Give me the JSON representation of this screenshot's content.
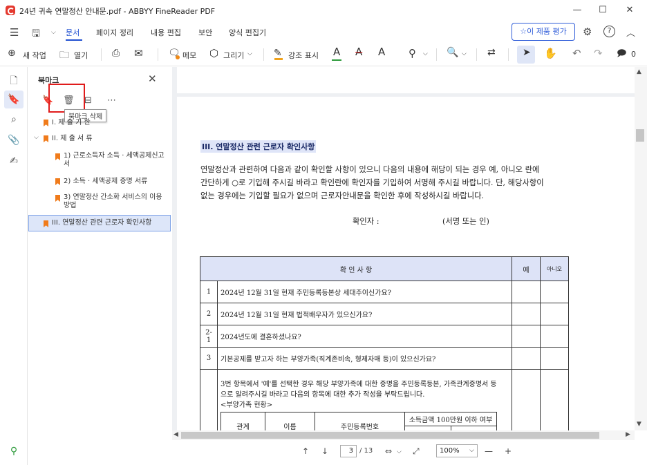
{
  "window": {
    "title": "24년 귀속 연말정산 안내문.pdf - ABBYY FineReader PDF",
    "minimize": "—",
    "maximize": "☐",
    "close": "✕"
  },
  "menu": {
    "items": [
      "문서",
      "페이지 정리",
      "내용 편집",
      "보안",
      "양식 편집기"
    ],
    "rate_label": "이 제품 평가"
  },
  "toolbar": {
    "new_task": "새 작업",
    "open": "열기",
    "memo": "메모",
    "draw": "그리기",
    "highlight": "강조 표시",
    "comment_count": "0"
  },
  "panel": {
    "title": "북마크",
    "tooltip": "북마크 삭제",
    "bookmarks": [
      {
        "label": "I. 제 출 기 한"
      },
      {
        "label": "II. 제 출 서 류"
      },
      {
        "label": "1) 근로소득자 소득 · 세액공제신고서"
      },
      {
        "label": "2) 소득 · 세액공제 증명 서류"
      },
      {
        "label": "3) 연말정산 간소화 서비스의 이용방법"
      },
      {
        "label": "III. 연말정산 관련 근로자 확인사항"
      }
    ]
  },
  "document": {
    "heading": "III. 연말정산 관련 근로자 확인사항",
    "paragraph": [
      "연말정산과 관련하여 다음과 같이 확인할 사항이 있으니 다음의 내용에 해당이 되는 경우 예, 아니오 란에",
      "간단하게 ○로 기입해 주시길 바라고 확인란에 확인자를 기입하여 서명해 주시길 바랍니다. 단, 해당사항이",
      "없는 경우에는 기입할 필요가 없으며 근로자안내문을 확인한 후에 작성하시길 바랍니다."
    ],
    "confirmer": "확인자 :",
    "sign": "(서명 또는 인)",
    "table": {
      "headers": [
        "확 인 사 항",
        "예",
        "아니오"
      ],
      "rows": [
        {
          "num": "1",
          "text": "2024년 12월 31일 현재 주민등록등본상 세대주이신가요?"
        },
        {
          "num": "2",
          "text": "2024년 12월 31일 현재 법적배우자가 있으신가요?"
        },
        {
          "num": "2-1",
          "text": "2024년도에 결혼하셨나요?"
        },
        {
          "num": "3",
          "text": "기본공제를 받고자 하는 부양가족(직계존비속, 형제자매 등)이 있으신가요?"
        }
      ],
      "note": [
        "3번 항목에서 '예'를 선택한 경우 해당 부양가족에 대한 증명을 주민등록등본, 가족관계증명서 등",
        "으로 알려주시길 바라고 다음의 항목에 대한 추가 작성을 부탁드립니다.",
        "<부양가족 현황>"
      ],
      "inner_headers": [
        "관계",
        "이름",
        "주민등록번호",
        "소득금액 100만원 이하 여부"
      ]
    }
  },
  "status": {
    "page": "3",
    "total": "/ 13",
    "zoom": "100%"
  }
}
